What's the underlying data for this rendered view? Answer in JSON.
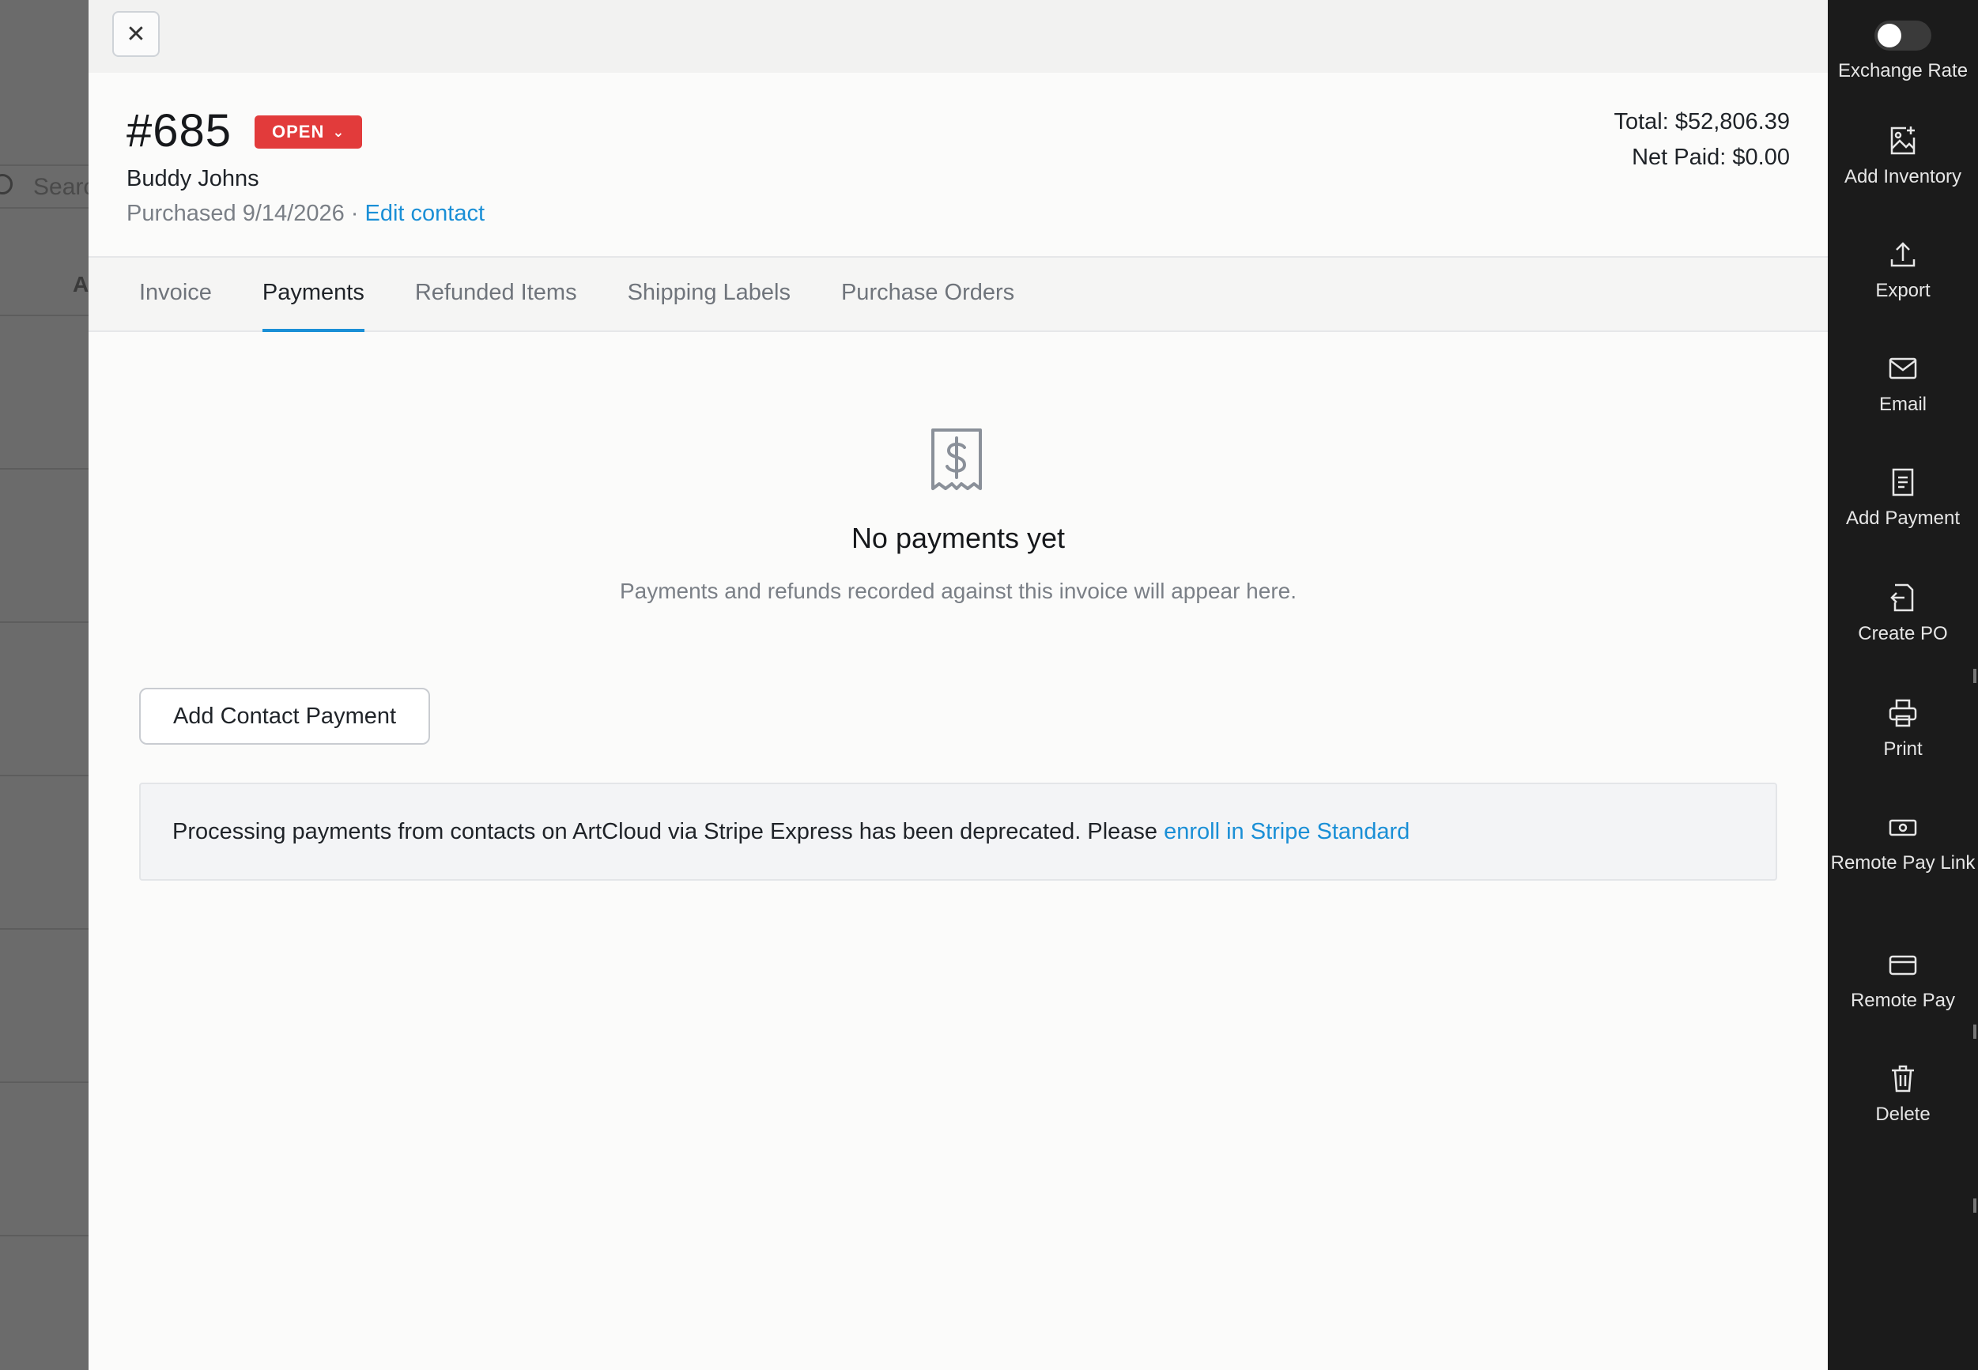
{
  "background": {
    "search_placeholder": "Searc",
    "column_letter": "A"
  },
  "header": {
    "invoice_number": "#685",
    "status": "OPEN",
    "contact_name": "Buddy Johns",
    "purchased": "Purchased 9/14/2026 · ",
    "edit_contact": "Edit contact",
    "total": "Total: $52,806.39",
    "net_paid": "Net Paid: $0.00"
  },
  "tabs": [
    {
      "label": "Invoice",
      "active": false
    },
    {
      "label": "Payments",
      "active": true
    },
    {
      "label": "Refunded Items",
      "active": false
    },
    {
      "label": "Shipping Labels",
      "active": false
    },
    {
      "label": "Purchase Orders",
      "active": false
    }
  ],
  "empty_state": {
    "icon": "receipt-dollar-icon",
    "title": "No payments yet",
    "subtitle": "Payments and refunds recorded against this invoice will appear here."
  },
  "add_contact_payment_label": "Add Contact Payment",
  "notice": {
    "text": "Processing payments from contacts on ArtCloud via Stripe Express has been deprecated. Please ",
    "link": "enroll in Stripe Standard"
  },
  "sidebar": [
    {
      "label": "Exchange Rate",
      "icon": "toggle",
      "value": "off"
    },
    {
      "label": "Add Inventory",
      "icon": "image-plus-icon"
    },
    {
      "label": "Export",
      "icon": "upload-icon"
    },
    {
      "label": "Email",
      "icon": "mail-icon"
    },
    {
      "label": "Add Payment",
      "icon": "receipt-icon"
    },
    {
      "label": "Create PO",
      "icon": "file-import-icon"
    },
    {
      "label": "Print",
      "icon": "printer-icon"
    },
    {
      "label": "Remote Pay Link",
      "icon": "cash-icon"
    },
    {
      "label": "Remote Pay",
      "icon": "credit-card-icon"
    },
    {
      "label": "Delete",
      "icon": "trash-icon"
    }
  ],
  "colors": {
    "accent": "#1a8fd6",
    "status_open": "#e23b3b",
    "sidebar_bg": "#1b1b1b"
  }
}
